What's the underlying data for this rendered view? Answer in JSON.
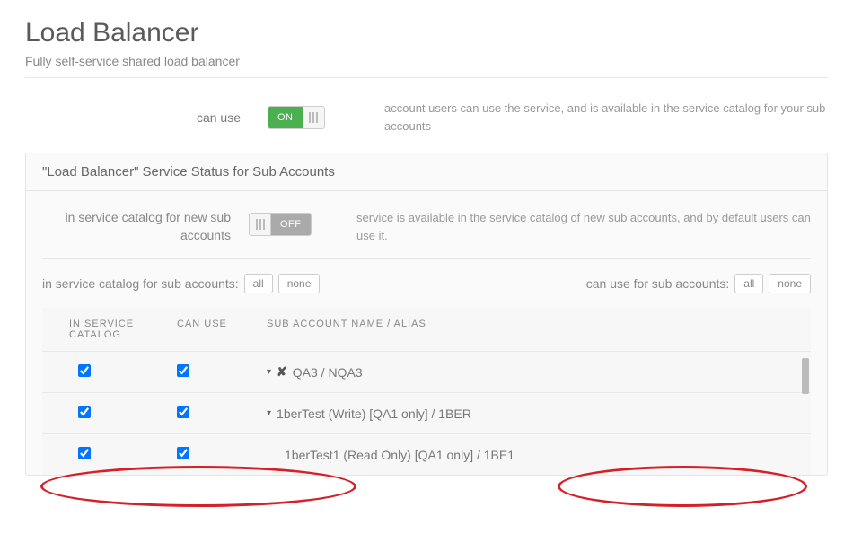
{
  "page": {
    "title": "Load Balancer",
    "subtitle": "Fully self-service shared load balancer"
  },
  "canUse": {
    "label": "can use",
    "toggleOn": "ON",
    "description": "account users can use the service, and is available in the service catalog for your sub accounts"
  },
  "panel": {
    "title": "\"Load Balancer\" Service Status for Sub Accounts"
  },
  "catalogNew": {
    "label": "in service catalog for new sub accounts",
    "toggleOff": "OFF",
    "description": "service is available in the service catalog of new sub accounts, and by default users can use it."
  },
  "filterLeft": {
    "label": "in service catalog for sub accounts:",
    "all": "all",
    "none": "none"
  },
  "filterRight": {
    "label": "can use for sub accounts:",
    "all": "all",
    "none": "none"
  },
  "table": {
    "headers": {
      "col1": "IN SERVICE CATALOG",
      "col2": "CAN USE",
      "col3": "SUB ACCOUNT NAME / ALIAS"
    },
    "rows": [
      {
        "inCatalog": true,
        "canUse": true,
        "name": "QA3 / NQA3",
        "hasCaret": true,
        "hasX": true,
        "indent": false
      },
      {
        "inCatalog": true,
        "canUse": true,
        "name": "1berTest (Write) [QA1 only] / 1BER",
        "hasCaret": true,
        "hasX": false,
        "indent": false
      },
      {
        "inCatalog": true,
        "canUse": true,
        "name": "1berTest1 (Read Only) [QA1 only] / 1BE1",
        "hasCaret": false,
        "hasX": false,
        "indent": true
      }
    ]
  }
}
